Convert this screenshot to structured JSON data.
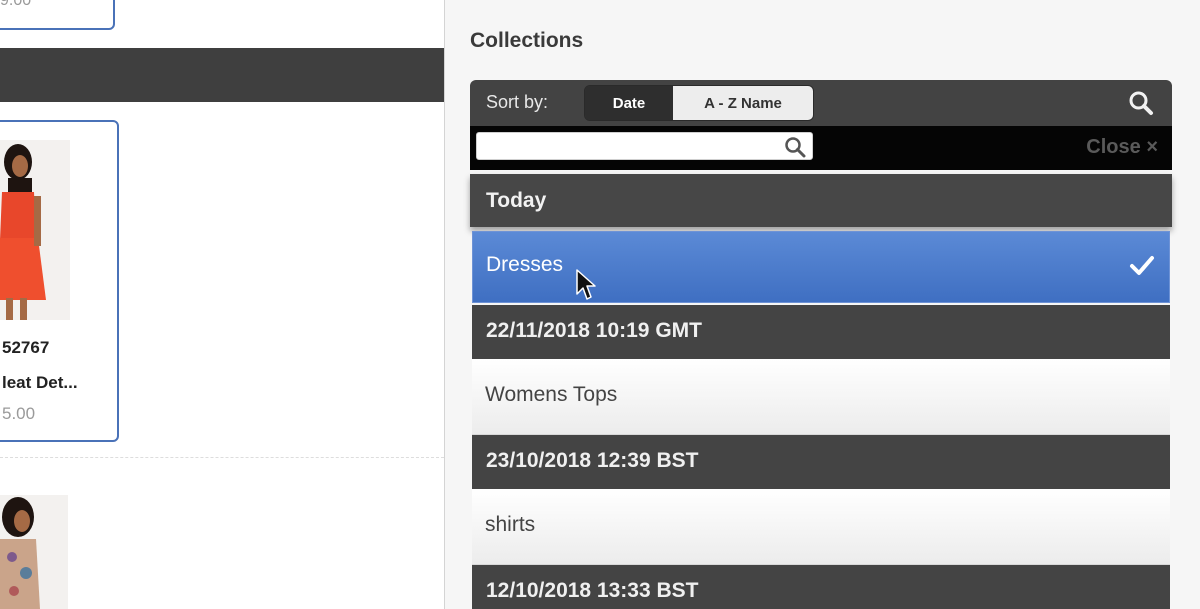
{
  "left_panel": {
    "top_card_price": "9.00",
    "product": {
      "sku": "52767",
      "name": "leat Det...",
      "price": "5.00"
    }
  },
  "collections_panel": {
    "title": "Collections",
    "sort": {
      "label": "Sort by:",
      "options": [
        "Date",
        "A - Z Name"
      ],
      "selected": "Date"
    },
    "search": {
      "value": "",
      "placeholder": ""
    },
    "close_label": "Close ×",
    "groups": [
      {
        "header": "Today",
        "items": [
          {
            "label": "Dresses",
            "selected": true
          }
        ]
      },
      {
        "header": "22/11/2018 10:19 GMT",
        "items": [
          {
            "label": "Womens Tops",
            "selected": false
          }
        ]
      },
      {
        "header": "23/10/2018 12:39 BST",
        "items": [
          {
            "label": "shirts",
            "selected": false
          }
        ]
      },
      {
        "header": "12/10/2018 13:33 BST",
        "items": []
      }
    ]
  },
  "colors": {
    "accent_blue": "#4a7bcc",
    "header_dark": "#444444",
    "card_border": "#4a72b8"
  },
  "icons": [
    "search-icon",
    "checkmark-icon",
    "close-icon",
    "mouse-cursor-icon"
  ]
}
